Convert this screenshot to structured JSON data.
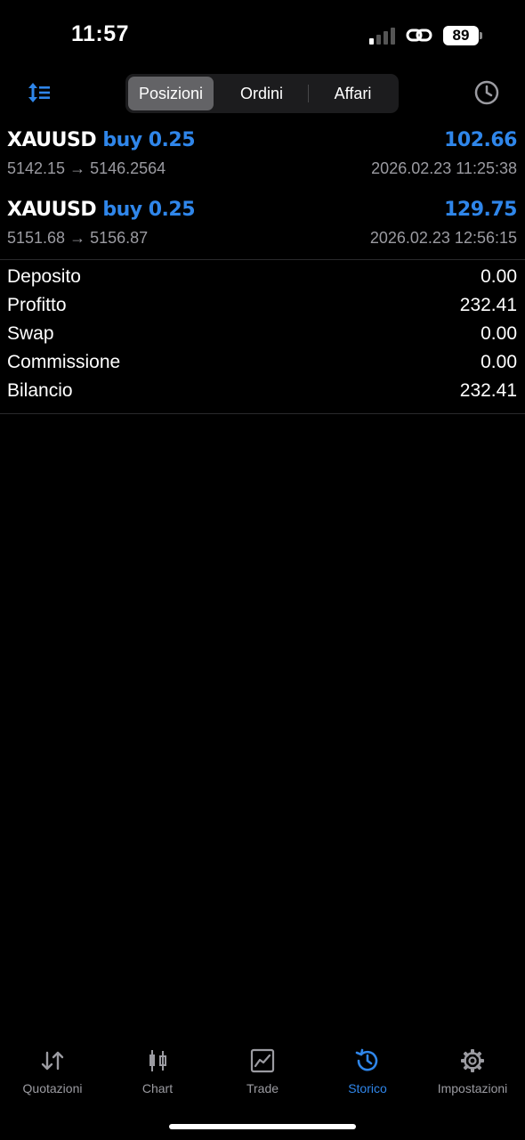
{
  "status_bar": {
    "time": "11:57",
    "battery": "89"
  },
  "toolbar": {
    "segments": [
      {
        "label": "Posizioni",
        "active": true
      },
      {
        "label": "Ordini",
        "active": false
      },
      {
        "label": "Affari",
        "active": false
      }
    ],
    "left_icon": "sort-icon",
    "right_icon": "clock-history-icon"
  },
  "trades": [
    {
      "symbol": "XAUUSD",
      "direction": "buy 0.25",
      "profit": "102.66",
      "prices": "5142.15 → 5146.2564",
      "time": "2026.02.23 11:25:38"
    },
    {
      "symbol": "XAUUSD",
      "direction": "buy 0.25",
      "profit": "129.75",
      "prices": "5151.68 → 5156.87",
      "time": "2026.02.23 12:56:15"
    }
  ],
  "summary": [
    {
      "label": "Deposito",
      "value": "0.00"
    },
    {
      "label": "Profitto",
      "value": "232.41"
    },
    {
      "label": "Swap",
      "value": "0.00"
    },
    {
      "label": "Commissione",
      "value": "0.00"
    },
    {
      "label": "Bilancio",
      "value": "232.41"
    }
  ],
  "tabs": [
    {
      "label": "Quotazioni",
      "icon": "quotes-arrows-icon",
      "active": false
    },
    {
      "label": "Chart",
      "icon": "candlestick-chart-icon",
      "active": false
    },
    {
      "label": "Trade",
      "icon": "trade-chart-icon",
      "active": false
    },
    {
      "label": "Storico",
      "icon": "history-icon",
      "active": true
    },
    {
      "label": "Impostazioni",
      "icon": "settings-gear-icon",
      "active": false
    }
  ],
  "colors": {
    "accent": "#2f86ea",
    "background": "#000000",
    "secondary_text": "#9b9ba1"
  }
}
